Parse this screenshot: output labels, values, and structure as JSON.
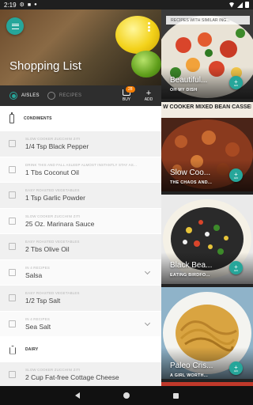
{
  "status": {
    "time": "2:19"
  },
  "header": {
    "title": "Shopping List"
  },
  "tabs": {
    "aisles": "AISLES",
    "recipes": "RECIPES"
  },
  "actions": {
    "buy_label": "BUY",
    "buy_count": "28",
    "add_label": "ADD"
  },
  "sections": [
    {
      "name": "CONDIMENTS",
      "icon": "bottle-icon"
    },
    {
      "name": "DAIRY",
      "icon": "milk-carton-icon"
    }
  ],
  "items": [
    {
      "sub": "SLOW COOKER ZUCCHINI ZITI",
      "name": "1/4 Tsp Black Pepper",
      "expand": false
    },
    {
      "sub": "DRINK THIS AND FALL ASLEEP ALMOST INSTANTLY STAY AS...",
      "name": "1 Tbs Coconut Oil",
      "expand": false
    },
    {
      "sub": "EASY ROASTED VEGETABLES",
      "name": "1 Tsp Garlic Powder",
      "expand": false
    },
    {
      "sub": "SLOW COOKER ZUCCHINI ZITI",
      "name": "25 Oz. Marinara Sauce",
      "expand": false
    },
    {
      "sub": "EASY ROASTED VEGETABLES",
      "name": "2 Tbs Olive Oil",
      "expand": false
    },
    {
      "sub": "IN 4 RECIPES",
      "name": "Salsa",
      "expand": true
    },
    {
      "sub": "EASY ROASTED VEGETABLES",
      "name": "1/2 Tsp Salt",
      "expand": false
    },
    {
      "sub": "IN 4 RECIPES",
      "name": "Sea Salt",
      "expand": true
    },
    {
      "sub": "SLOW COOKER ZUCCHINI ZITI",
      "name": "2 Cup Fat-free Cottage Cheese",
      "expand": false
    }
  ],
  "similar": {
    "header": "RECIPES WITH SIMILAR ING...",
    "cards": [
      {
        "title": "Beautiful...",
        "source": "OH MY DISH",
        "add": "ADD"
      },
      {
        "title": "Slow Coo...",
        "source": "THE CHAOS AND...",
        "add": "ADD",
        "top_text": "W COOKER MIXED BEAN CASSER"
      },
      {
        "title": "Black Bea...",
        "source": "EATING BIRDFO...",
        "add": "ADD"
      },
      {
        "title": "Paleo Cris...",
        "source": "A GIRL WORTH...",
        "add": "ADD"
      }
    ]
  }
}
